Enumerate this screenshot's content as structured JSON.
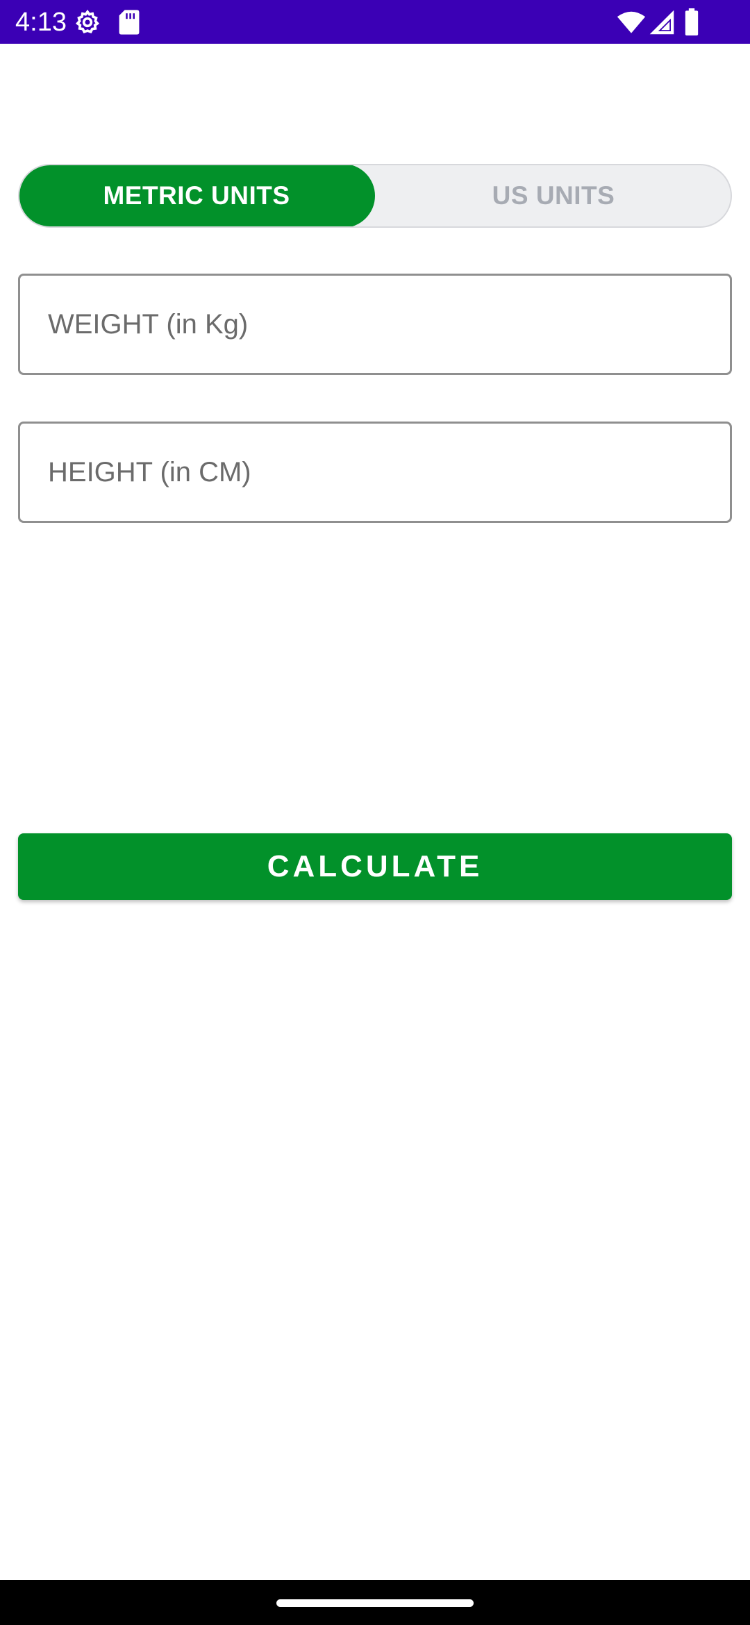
{
  "status_bar": {
    "time": "4:13",
    "icons": [
      "settings-gear-icon",
      "sd-card-icon",
      "wifi-icon",
      "cell-signal-icon",
      "battery-icon"
    ],
    "background": "#3b00b5"
  },
  "units_toggle": {
    "options": [
      "METRIC UNITS",
      "US UNITS"
    ],
    "selected": "METRIC UNITS",
    "active_color": "#02912a",
    "inactive_text_color": "#a7abb3"
  },
  "form": {
    "weight": {
      "placeholder": "WEIGHT (in Kg)",
      "value": ""
    },
    "height": {
      "placeholder": "HEIGHT (in CM)",
      "value": ""
    }
  },
  "actions": {
    "calculate_label": "CALCULATE",
    "button_color": "#02912a"
  }
}
